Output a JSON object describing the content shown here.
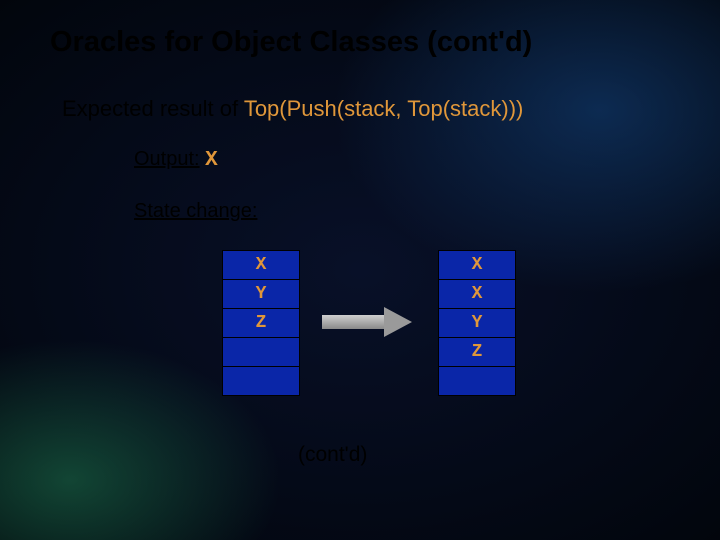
{
  "title": "Oracles for Object Classes (cont'd)",
  "subtitle_prefix": "Expected result of ",
  "subtitle_expr": "Top(Push(stack, Top(stack)))",
  "output_label": "Output:",
  "output_value": "X",
  "state_label": "State change:",
  "left_stack": [
    "X",
    "Y",
    "Z",
    "",
    ""
  ],
  "right_stack": [
    "X",
    "X",
    "Y",
    "Z",
    ""
  ],
  "contd": "(cont'd)"
}
